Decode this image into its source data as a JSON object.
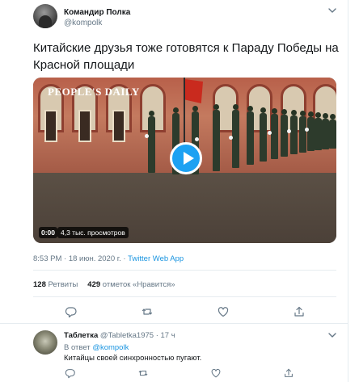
{
  "tweet": {
    "author_name": "Командир Полка",
    "author_handle": "@kompolk",
    "text": "Китайские друзья тоже готовятся к Параду Победы на Красной площади",
    "video": {
      "watermark": "PEOPLE'S DAILY",
      "duration": "0:00",
      "views": "4,3 тыс. просмотров"
    },
    "time": "8:53 PM · 18 июн. 2020 г. · ",
    "source": "Twitter Web App",
    "retweets_count": "128",
    "retweets_label": "Ретвиты",
    "likes_count": "429",
    "likes_label": "отметок «Нравится»",
    "icons": [
      "chevron-down-icon",
      "reply-icon",
      "retweet-icon",
      "like-icon",
      "share-icon"
    ]
  },
  "reply": {
    "author_name": "Таблетка",
    "author_handle": "@Tabletka1975",
    "time": "· 17 ч",
    "in_reply_prefix": "В ответ ",
    "in_reply_mention": "@kompolk",
    "text": "Китайцы своей синхронностью пугают."
  },
  "colors": {
    "accent": "#1da1f2",
    "link": "#1b95e0",
    "text": "#14171a",
    "muted": "#657786",
    "border": "#e6ecf0"
  }
}
